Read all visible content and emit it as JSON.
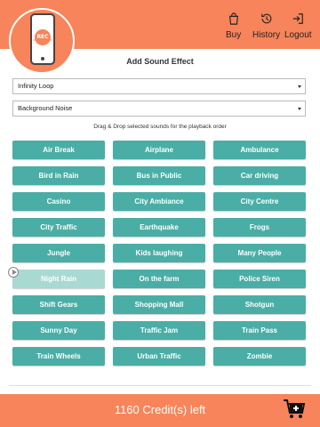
{
  "header": {
    "logo_text": "REC",
    "nav": [
      {
        "label": "Buy",
        "icon": "shopping-bag-icon"
      },
      {
        "label": "History",
        "icon": "history-icon"
      },
      {
        "label": "Logout",
        "icon": "logout-icon"
      }
    ]
  },
  "page": {
    "title": "Add Sound Effect",
    "loop_select": "Infinity Loop",
    "background_select": "Background Noise",
    "hint": "Drag & Drop selected sounds for the playback order"
  },
  "sounds": [
    "Air Break",
    "Airplane",
    "Ambulance",
    "Bird in Rain",
    "Bus in Public",
    "Car driving",
    "Casino",
    "City Ambiance",
    "City Centre",
    "City Traffic",
    "Earthquake",
    "Frogs",
    "Jungle",
    "Kids laughing",
    "Many People",
    "Night Rain",
    "On the farm",
    "Police Siren",
    "Shift Gears",
    "Shopping Mall",
    "Shotgun",
    "Sunny Day",
    "Traffic Jam",
    "Train Pass",
    "Train Wheels",
    "Urban Traffic",
    "Zombie"
  ],
  "playing_sound": "Night Rain",
  "footer": {
    "credits": "1160 Credit(s) left"
  },
  "colors": {
    "accent": "#f7845a",
    "button": "#4aaea6",
    "button_active": "#a9d9d3"
  }
}
